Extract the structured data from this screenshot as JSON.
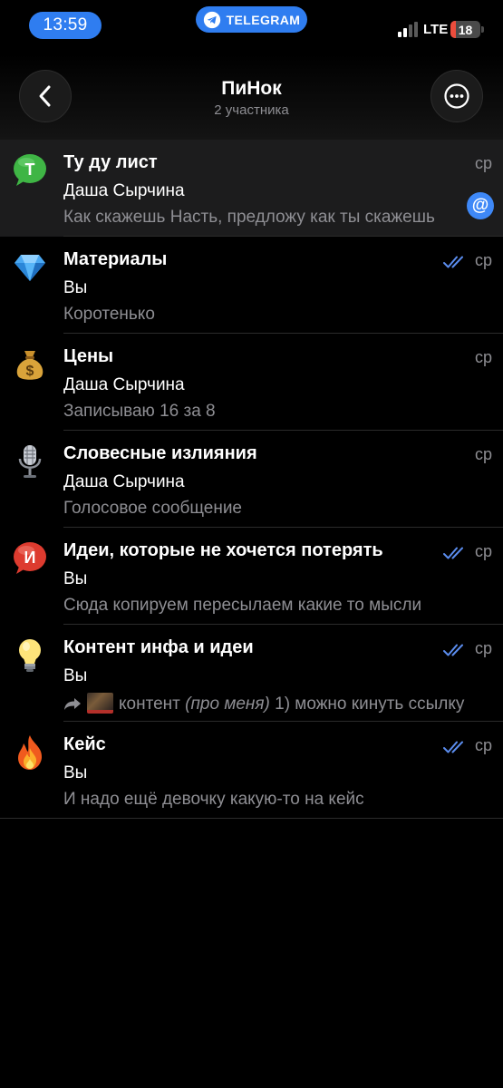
{
  "status_bar": {
    "time": "13:59",
    "app_pill": "TELEGRAM",
    "network": "LTE",
    "battery": "18",
    "battery_level": 0.18
  },
  "header": {
    "title": "ПиНок",
    "subtitle": "2 участника",
    "back_icon": "chevron-left-icon",
    "more_icon": "ellipsis-icon"
  },
  "topics": [
    {
      "title": "Ту ду лист",
      "sender": "Даша Сырчина",
      "preview": "Как скажешь Насть, предложу как ты скажешь",
      "date": "ср",
      "icon": "green-speech-bubble-T",
      "mention": "@",
      "read": false
    },
    {
      "title": "Материалы",
      "sender": "Вы",
      "preview": "Коротенько",
      "date": "ср",
      "icon": "gem-icon",
      "read": true
    },
    {
      "title": "Цены",
      "sender": "Даша Сырчина",
      "preview": "Записываю 16 за 8",
      "date": "ср",
      "icon": "money-bag-icon",
      "read": false
    },
    {
      "title": "Словесные излияния",
      "sender": "Даша Сырчина",
      "preview": "Голосовое сообщение",
      "date": "ср",
      "icon": "microphone-icon",
      "read": false
    },
    {
      "title": "Идеи, которые не хочется потерять",
      "sender": "Вы",
      "preview": "Сюда копируем пересылаем какие то мысли",
      "date": "ср",
      "icon": "red-speech-bubble-I",
      "read": true
    },
    {
      "title": "Контент инфа и идеи",
      "sender": "Вы",
      "preview_prefix": "контент ",
      "preview_italic": "(про меня)",
      "preview_suffix": " 1) можно кинуть ссылку",
      "date": "ср",
      "icon": "light-bulb-icon",
      "read": true
    },
    {
      "title": "Кейс",
      "sender": "Вы",
      "preview": "И надо ещё девочку какую-то на кейс",
      "date": "ср",
      "icon": "fire-icon",
      "read": true
    }
  ],
  "colors": {
    "accent": "#2f7df0",
    "check": "#5b8def",
    "mention": "#3e88f7",
    "muted": "#8e8e93",
    "highlight_row": "#1c1c1d"
  }
}
